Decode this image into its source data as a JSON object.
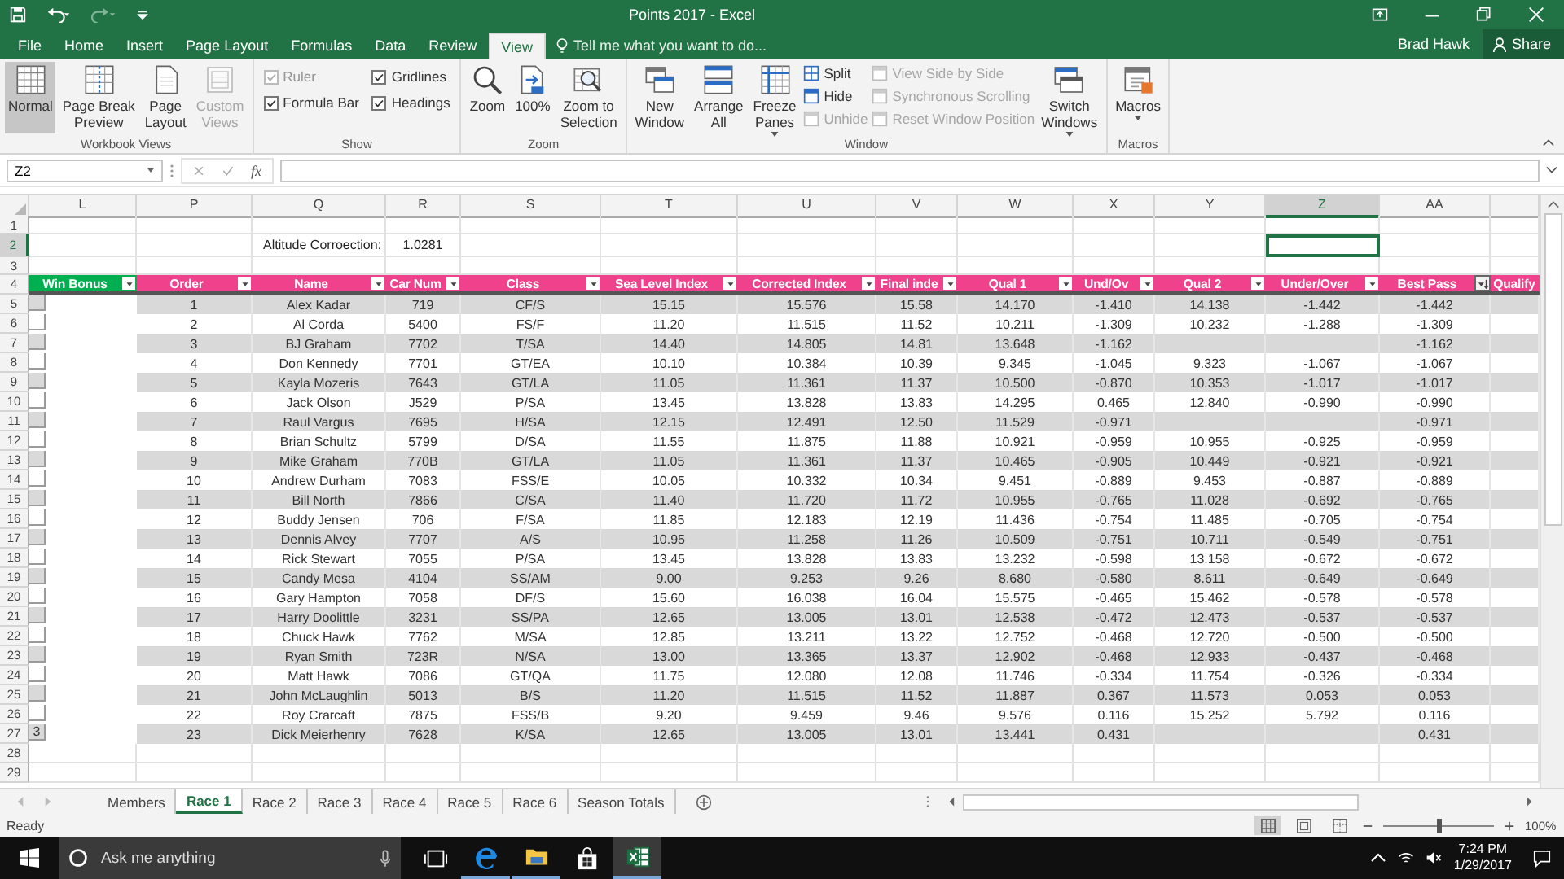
{
  "title_bar": {
    "title": "Points 2017 - Excel"
  },
  "ribbon_tabs": [
    {
      "label": "File",
      "selected": false
    },
    {
      "label": "Home",
      "selected": false
    },
    {
      "label": "Insert",
      "selected": false
    },
    {
      "label": "Page Layout",
      "selected": false
    },
    {
      "label": "Formulas",
      "selected": false
    },
    {
      "label": "Data",
      "selected": false
    },
    {
      "label": "Review",
      "selected": false
    },
    {
      "label": "View",
      "selected": true
    }
  ],
  "tell_me": {
    "placeholder": "Tell me what you want to do..."
  },
  "account": {
    "user": "Brad Hawk",
    "share": "Share"
  },
  "ribbon_groups": [
    {
      "label": "Workbook Views",
      "items": [
        {
          "kind": "large",
          "label": "Normal",
          "selected": true,
          "disabled": false
        },
        {
          "kind": "large",
          "label": "Page Break\nPreview",
          "selected": false,
          "disabled": false
        },
        {
          "kind": "large",
          "label": "Page\nLayout",
          "selected": false,
          "disabled": false
        },
        {
          "kind": "large",
          "label": "Custom\nViews",
          "selected": false,
          "disabled": true
        }
      ]
    },
    {
      "label": "Show",
      "items": [
        {
          "kind": "check",
          "label": "Ruler",
          "checked": true,
          "disabled": true
        },
        {
          "kind": "check",
          "label": "Formula Bar",
          "checked": true,
          "disabled": false
        },
        {
          "kind": "check",
          "label": "Gridlines",
          "checked": true,
          "disabled": false
        },
        {
          "kind": "check",
          "label": "Headings",
          "checked": true,
          "disabled": false
        }
      ]
    },
    {
      "label": "Zoom",
      "items": [
        {
          "kind": "large",
          "label": "Zoom",
          "selected": false,
          "disabled": false
        },
        {
          "kind": "large",
          "label": "100%",
          "selected": false,
          "disabled": false
        },
        {
          "kind": "large",
          "label": "Zoom to\nSelection",
          "selected": false,
          "disabled": false
        }
      ]
    },
    {
      "label": "Window",
      "items": [
        {
          "kind": "large",
          "label": "New\nWindow",
          "selected": false,
          "disabled": false
        },
        {
          "kind": "large",
          "label": "Arrange\nAll",
          "selected": false,
          "disabled": false
        },
        {
          "kind": "large",
          "label": "Freeze\nPanes",
          "selected": false,
          "disabled": false,
          "dropdown": true
        },
        {
          "kind": "small",
          "label": "Split",
          "disabled": false
        },
        {
          "kind": "small",
          "label": "Hide",
          "disabled": false
        },
        {
          "kind": "small",
          "label": "Unhide",
          "disabled": true
        },
        {
          "kind": "small",
          "label": "View Side by Side",
          "disabled": true
        },
        {
          "kind": "small",
          "label": "Synchronous Scrolling",
          "disabled": true
        },
        {
          "kind": "small",
          "label": "Reset Window Position",
          "disabled": true
        },
        {
          "kind": "large",
          "label": "Switch\nWindows",
          "selected": false,
          "disabled": false,
          "dropdown": true
        }
      ]
    },
    {
      "label": "Macros",
      "items": [
        {
          "kind": "large",
          "label": "Macros",
          "selected": false,
          "disabled": false,
          "dropdown": true
        }
      ]
    }
  ],
  "formula_bar": {
    "name_box": "Z2",
    "function_label": "fx"
  },
  "sheet": {
    "column_letters": [
      {
        "label": "L",
        "selected": false
      },
      {
        "label": "P",
        "selected": false
      },
      {
        "label": "Q",
        "selected": false
      },
      {
        "label": "R",
        "selected": false
      },
      {
        "label": "S",
        "selected": false
      },
      {
        "label": "T",
        "selected": false
      },
      {
        "label": "U",
        "selected": false
      },
      {
        "label": "V",
        "selected": false
      },
      {
        "label": "W",
        "selected": false
      },
      {
        "label": "X",
        "selected": false
      },
      {
        "label": "Y",
        "selected": false
      },
      {
        "label": "Z",
        "selected": true
      },
      {
        "label": "AA",
        "selected": false
      }
    ],
    "row_numbers": [
      {
        "label": "1",
        "selected": false
      },
      {
        "label": "2",
        "selected": true
      },
      {
        "label": "3",
        "selected": false
      },
      {
        "label": "4",
        "selected": false
      },
      {
        "label": "5",
        "selected": false
      },
      {
        "label": "6",
        "selected": false
      },
      {
        "label": "7",
        "selected": false
      },
      {
        "label": "8",
        "selected": false
      },
      {
        "label": "9",
        "selected": false
      },
      {
        "label": "10",
        "selected": false
      },
      {
        "label": "11",
        "selected": false
      },
      {
        "label": "12",
        "selected": false
      },
      {
        "label": "13",
        "selected": false
      },
      {
        "label": "14",
        "selected": false
      },
      {
        "label": "15",
        "selected": false
      },
      {
        "label": "16",
        "selected": false
      },
      {
        "label": "17",
        "selected": false
      },
      {
        "label": "18",
        "selected": false
      },
      {
        "label": "19",
        "selected": false
      },
      {
        "label": "20",
        "selected": false
      },
      {
        "label": "21",
        "selected": false
      },
      {
        "label": "22",
        "selected": false
      },
      {
        "label": "23",
        "selected": false
      },
      {
        "label": "24",
        "selected": false
      },
      {
        "label": "25",
        "selected": false
      },
      {
        "label": "26",
        "selected": false
      },
      {
        "label": "27",
        "selected": false
      },
      {
        "label": "28",
        "selected": false
      },
      {
        "label": "29",
        "selected": false
      }
    ],
    "altitude": {
      "label": "Altitude Corroection:",
      "value": "1.0281"
    },
    "table": {
      "columns": [
        {
          "label": "Win Bonus",
          "color": "#00b050",
          "kind": "filter"
        },
        {
          "label": "Order",
          "color": "#f0418c",
          "kind": "filter"
        },
        {
          "label": "Name",
          "color": "#f0418c",
          "kind": "filter"
        },
        {
          "label": "Car Num",
          "color": "#f0418c",
          "kind": "filter"
        },
        {
          "label": "Class",
          "color": "#f0418c",
          "kind": "filter"
        },
        {
          "label": "Sea Level Index",
          "color": "#f0418c",
          "kind": "filter"
        },
        {
          "label": "Corrected Index",
          "color": "#f0418c",
          "kind": "filter"
        },
        {
          "label": "Final inde",
          "color": "#f0418c",
          "kind": "filter"
        },
        {
          "label": "Qual 1",
          "color": "#f0418c",
          "kind": "filter"
        },
        {
          "label": "Und/Ov",
          "color": "#f0418c",
          "kind": "filter"
        },
        {
          "label": "Qual 2",
          "color": "#f0418c",
          "kind": "filter"
        },
        {
          "label": "Under/Over",
          "color": "#f0418c",
          "kind": "filter"
        },
        {
          "label": "Best Pass",
          "color": "#f0418c",
          "kind": "sorted"
        },
        {
          "label": "Qualify",
          "color": "#f0418c",
          "kind": "plain"
        }
      ],
      "rows": [
        {
          "order": "1",
          "name": "Alex Kadar",
          "car": "719",
          "class": "CF/S",
          "sea_level": "15.15",
          "corrected": "15.576",
          "final": "15.58",
          "qual_1": "14.170",
          "under_over_1": "-1.410",
          "qual_2": "14.138",
          "under_over_2": "-1.442",
          "best_pass": "-1.442"
        },
        {
          "order": "2",
          "name": "Al Corda",
          "car": "5400",
          "class": "FS/F",
          "sea_level": "11.20",
          "corrected": "11.515",
          "final": "11.52",
          "qual_1": "10.211",
          "under_over_1": "-1.309",
          "qual_2": "10.232",
          "under_over_2": "-1.288",
          "best_pass": "-1.309"
        },
        {
          "order": "3",
          "name": "BJ Graham",
          "car": "7702",
          "class": "T/SA",
          "sea_level": "14.40",
          "corrected": "14.805",
          "final": "14.81",
          "qual_1": "13.648",
          "under_over_1": "-1.162",
          "best_pass": "-1.162"
        },
        {
          "order": "4",
          "name": "Don Kennedy",
          "car": "7701",
          "class": "GT/EA",
          "sea_level": "10.10",
          "corrected": "10.384",
          "final": "10.39",
          "qual_1": "9.345",
          "under_over_1": "-1.045",
          "qual_2": "9.323",
          "under_over_2": "-1.067",
          "best_pass": "-1.067"
        },
        {
          "order": "5",
          "name": "Kayla Mozeris",
          "car": "7643",
          "class": "GT/LA",
          "sea_level": "11.05",
          "corrected": "11.361",
          "final": "11.37",
          "qual_1": "10.500",
          "under_over_1": "-0.870",
          "qual_2": "10.353",
          "under_over_2": "-1.017",
          "best_pass": "-1.017"
        },
        {
          "order": "6",
          "name": "Jack Olson",
          "car": "J529",
          "class": "P/SA",
          "sea_level": "13.45",
          "corrected": "13.828",
          "final": "13.83",
          "qual_1": "14.295",
          "under_over_1": "0.465",
          "qual_2": "12.840",
          "under_over_2": "-0.990",
          "best_pass": "-0.990"
        },
        {
          "order": "7",
          "name": "Raul Vargus",
          "car": "7695",
          "class": "H/SA",
          "sea_level": "12.15",
          "corrected": "12.491",
          "final": "12.50",
          "qual_1": "11.529",
          "under_over_1": "-0.971",
          "best_pass": "-0.971"
        },
        {
          "order": "8",
          "name": "Brian Schultz",
          "car": "5799",
          "class": "D/SA",
          "sea_level": "11.55",
          "corrected": "11.875",
          "final": "11.88",
          "qual_1": "10.921",
          "under_over_1": "-0.959",
          "qual_2": "10.955",
          "under_over_2": "-0.925",
          "best_pass": "-0.959"
        },
        {
          "order": "9",
          "name": "Mike Graham",
          "car": "770B",
          "class": "GT/LA",
          "sea_level": "11.05",
          "corrected": "11.361",
          "final": "11.37",
          "qual_1": "10.465",
          "under_over_1": "-0.905",
          "qual_2": "10.449",
          "under_over_2": "-0.921",
          "best_pass": "-0.921"
        },
        {
          "order": "10",
          "name": "Andrew Durham",
          "car": "7083",
          "class": "FSS/E",
          "sea_level": "10.05",
          "corrected": "10.332",
          "final": "10.34",
          "qual_1": "9.451",
          "under_over_1": "-0.889",
          "qual_2": "9.453",
          "under_over_2": "-0.887",
          "best_pass": "-0.889"
        },
        {
          "order": "11",
          "name": "Bill North",
          "car": "7866",
          "class": "C/SA",
          "sea_level": "11.40",
          "corrected": "11.720",
          "final": "11.72",
          "qual_1": "10.955",
          "under_over_1": "-0.765",
          "qual_2": "11.028",
          "under_over_2": "-0.692",
          "best_pass": "-0.765"
        },
        {
          "order": "12",
          "name": "Buddy Jensen",
          "car": "706",
          "class": "F/SA",
          "sea_level": "11.85",
          "corrected": "12.183",
          "final": "12.19",
          "qual_1": "11.436",
          "under_over_1": "-0.754",
          "qual_2": "11.485",
          "under_over_2": "-0.705",
          "best_pass": "-0.754"
        },
        {
          "order": "13",
          "name": "Dennis Alvey",
          "car": "7707",
          "class": "A/S",
          "sea_level": "10.95",
          "corrected": "11.258",
          "final": "11.26",
          "qual_1": "10.509",
          "under_over_1": "-0.751",
          "qual_2": "10.711",
          "under_over_2": "-0.549",
          "best_pass": "-0.751"
        },
        {
          "order": "14",
          "name": "Rick Stewart",
          "car": "7055",
          "class": "P/SA",
          "sea_level": "13.45",
          "corrected": "13.828",
          "final": "13.83",
          "qual_1": "13.232",
          "under_over_1": "-0.598",
          "qual_2": "13.158",
          "under_over_2": "-0.672",
          "best_pass": "-0.672"
        },
        {
          "order": "15",
          "name": "Candy Mesa",
          "car": "4104",
          "class": "SS/AM",
          "sea_level": "9.00",
          "corrected": "9.253",
          "final": "9.26",
          "qual_1": "8.680",
          "under_over_1": "-0.580",
          "qual_2": "8.611",
          "under_over_2": "-0.649",
          "best_pass": "-0.649"
        },
        {
          "order": "16",
          "name": "Gary Hampton",
          "car": "7058",
          "class": "DF/S",
          "sea_level": "15.60",
          "corrected": "16.038",
          "final": "16.04",
          "qual_1": "15.575",
          "under_over_1": "-0.465",
          "qual_2": "15.462",
          "under_over_2": "-0.578",
          "best_pass": "-0.578"
        },
        {
          "order": "17",
          "name": "Harry Doolittle",
          "car": "3231",
          "class": "SS/PA",
          "sea_level": "12.65",
          "corrected": "13.005",
          "final": "13.01",
          "qual_1": "12.538",
          "under_over_1": "-0.472",
          "qual_2": "12.473",
          "under_over_2": "-0.537",
          "best_pass": "-0.537"
        },
        {
          "order": "18",
          "name": "Chuck Hawk",
          "car": "7762",
          "class": "M/SA",
          "sea_level": "12.85",
          "corrected": "13.211",
          "final": "13.22",
          "qual_1": "12.752",
          "under_over_1": "-0.468",
          "qual_2": "12.720",
          "under_over_2": "-0.500",
          "best_pass": "-0.500"
        },
        {
          "order": "19",
          "name": "Ryan Smith",
          "car": "723R",
          "class": "N/SA",
          "sea_level": "13.00",
          "corrected": "13.365",
          "final": "13.37",
          "qual_1": "12.902",
          "under_over_1": "-0.468",
          "qual_2": "12.933",
          "under_over_2": "-0.437",
          "best_pass": "-0.468"
        },
        {
          "order": "20",
          "name": "Matt Hawk",
          "car": "7086",
          "class": "GT/QA",
          "sea_level": "11.75",
          "corrected": "12.080",
          "final": "12.08",
          "qual_1": "11.746",
          "under_over_1": "-0.334",
          "qual_2": "11.754",
          "under_over_2": "-0.326",
          "best_pass": "-0.334"
        },
        {
          "order": "21",
          "name": "John McLaughlin",
          "car": "5013",
          "class": "B/S",
          "sea_level": "11.20",
          "corrected": "11.515",
          "final": "11.52",
          "qual_1": "11.887",
          "under_over_1": "0.367",
          "qual_2": "11.573",
          "under_over_2": "0.053",
          "best_pass": "0.053"
        },
        {
          "order": "22",
          "name": "Roy Crarcaft",
          "car": "7875",
          "class": "FSS/B",
          "sea_level": "9.20",
          "corrected": "9.459",
          "final": "9.46",
          "qual_1": "9.576",
          "under_over_1": "0.116",
          "qual_2": "15.252",
          "under_over_2": "5.792",
          "best_pass": "0.116"
        },
        {
          "win_bonus": "3",
          "order": "23",
          "name": "Dick Meierhenry",
          "car": "7628",
          "class": "K/SA",
          "sea_level": "12.65",
          "corrected": "13.005",
          "final": "13.01",
          "qual_1": "13.441",
          "under_over_1": "0.431",
          "best_pass": "0.431"
        }
      ]
    }
  },
  "sheet_tabs": [
    {
      "label": "Members",
      "selected": false
    },
    {
      "label": "Race 1",
      "selected": true
    },
    {
      "label": "Race 2",
      "selected": false
    },
    {
      "label": "Race 3",
      "selected": false
    },
    {
      "label": "Race 4",
      "selected": false
    },
    {
      "label": "Race 5",
      "selected": false
    },
    {
      "label": "Race 6",
      "selected": false
    },
    {
      "label": "Season Totals",
      "selected": false
    }
  ],
  "status_bar": {
    "status": "Ready",
    "views": [
      {
        "selected": true
      },
      {
        "selected": false
      },
      {
        "selected": false
      }
    ],
    "zoom": {
      "level": 0.5,
      "reading": "100%"
    }
  },
  "taskbar": {
    "search_placeholder": "Ask me anything",
    "apps": [
      {
        "running": false,
        "active": false
      },
      {
        "running": true,
        "active": false
      },
      {
        "running": true,
        "active": false
      },
      {
        "running": false,
        "active": false
      },
      {
        "running": true,
        "active": true
      }
    ],
    "time": "7:24 PM",
    "date": "1/29/2017"
  }
}
